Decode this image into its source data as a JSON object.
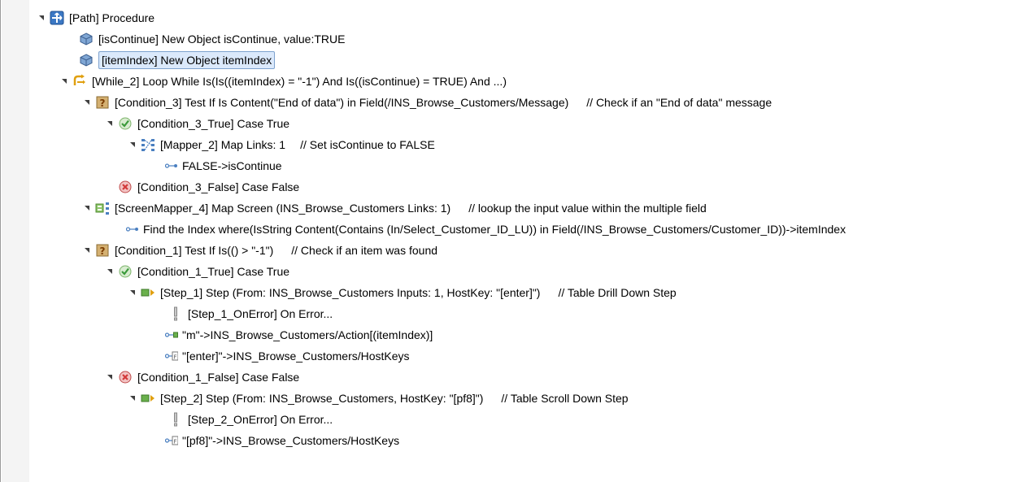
{
  "tree": {
    "root": {
      "label": "[Path] Procedure"
    },
    "n1": {
      "label": "[isContinue] New Object isContinue, value:TRUE"
    },
    "n2": {
      "label": "[itemIndex] New Object itemIndex"
    },
    "n3": {
      "label": "[While_2] Loop While Is(Is((itemIndex) = \"-1\")  And  Is((isContinue) = TRUE) And ...)"
    },
    "n4": {
      "label": "[Condition_3] Test If Is Content(\"End of data\") in Field(/INS_Browse_Customers/Message)",
      "comment": "// Check if an \"End of data\" message"
    },
    "n5": {
      "label": "[Condition_3_True] Case True"
    },
    "n6": {
      "label": "[Mapper_2] Map  Links: 1",
      "comment": "// Set isContinue to FALSE"
    },
    "n7": {
      "label": "FALSE->isContinue"
    },
    "n8": {
      "label": "[Condition_3_False] Case False"
    },
    "n9": {
      "label": "[ScreenMapper_4] Map Screen (INS_Browse_Customers Links: 1)",
      "comment": "// lookup the input value within the multiple field"
    },
    "n10": {
      "label": "Find the Index where(IsString Content(Contains (In/Select_Customer_ID_LU)) in Field(/INS_Browse_Customers/Customer_ID))->itemIndex"
    },
    "n11": {
      "label": "[Condition_1] Test If Is(() > \"-1\")",
      "comment": "// Check if an item was found"
    },
    "n12": {
      "label": "[Condition_1_True] Case True"
    },
    "n13": {
      "label": "[Step_1] Step (From: INS_Browse_Customers Inputs: 1, HostKey: \"[enter]\")",
      "comment": "// Table Drill Down Step"
    },
    "n14": {
      "label": "[Step_1_OnError] On Error..."
    },
    "n15": {
      "label": "\"m\"->INS_Browse_Customers/Action[(itemIndex)]"
    },
    "n16": {
      "label": "\"[enter]\"->INS_Browse_Customers/HostKeys"
    },
    "n17": {
      "label": "[Condition_1_False] Case False"
    },
    "n18": {
      "label": "[Step_2] Step (From: INS_Browse_Customers, HostKey: \"[pf8]\")",
      "comment": "// Table Scroll Down Step"
    },
    "n19": {
      "label": "[Step_2_OnError] On Error..."
    },
    "n20": {
      "label": "\"[pf8]\"->INS_Browse_Customers/HostKeys"
    }
  },
  "colors": {
    "selection_bg": "#dbe9fb",
    "selection_border": "#7da2ce",
    "true_check": "#3a9a3a",
    "false_x": "#d23a3a",
    "loop_orange": "#e0a010",
    "question_tan": "#c8a060"
  },
  "icons": {
    "root": "path-procedure-icon",
    "object": "object-cube-icon",
    "loop": "while-loop-icon",
    "condition": "condition-question-icon",
    "case_true": "case-true-check-icon",
    "case_false": "case-false-x-icon",
    "mapper": "mapper-icon",
    "screenmapper": "screen-mapper-icon",
    "step": "step-icon",
    "error": "on-error-icon",
    "link": "link-mapping-icon"
  }
}
